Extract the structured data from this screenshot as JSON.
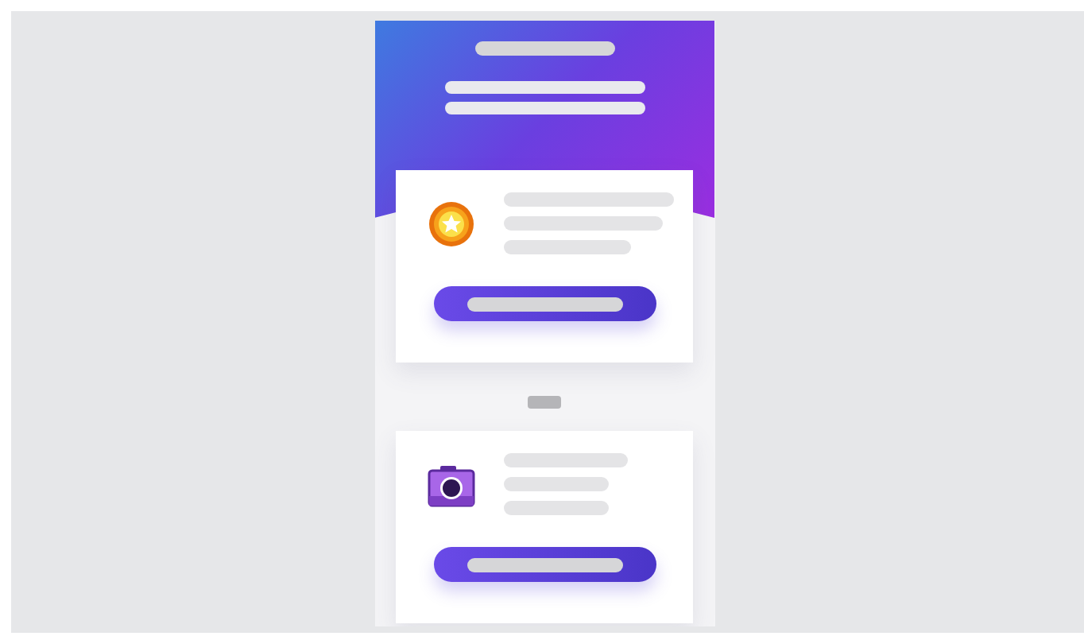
{
  "cards": [
    {
      "kind": "medal"
    },
    {
      "kind": "camera"
    }
  ]
}
